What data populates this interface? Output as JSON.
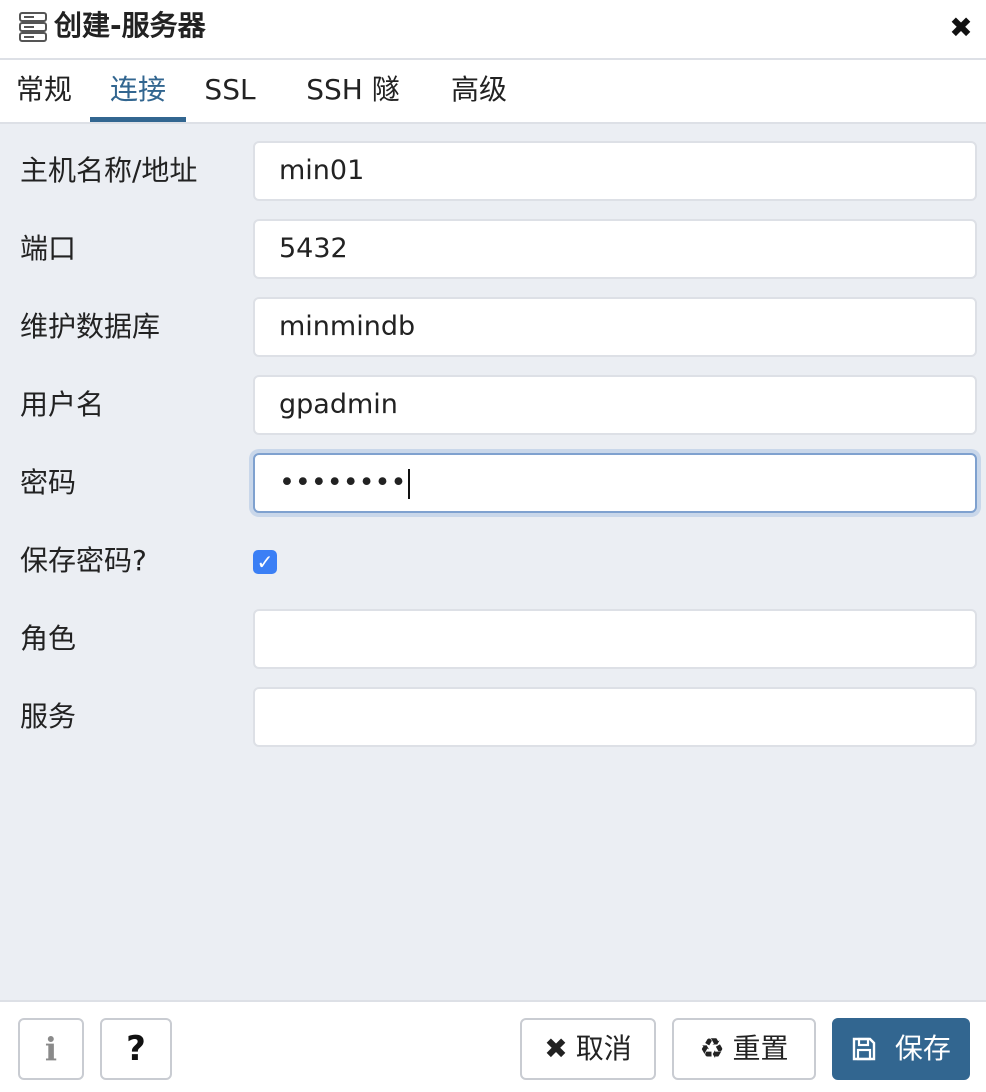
{
  "dialog": {
    "title": "创建-服务器",
    "icons": {
      "title": "server-icon",
      "close": "close-icon"
    },
    "close_glyph": "✖"
  },
  "tabs": [
    {
      "label": "常规",
      "active": false
    },
    {
      "label": "连接",
      "active": true
    },
    {
      "label": "SSL",
      "active": false
    },
    {
      "label": "SSH 隧道",
      "active": false
    },
    {
      "label": "高级",
      "active": false
    }
  ],
  "fields": {
    "host": {
      "label": "主机名称/地址",
      "value": "min01"
    },
    "port": {
      "label": "端口",
      "value": "5432"
    },
    "maintenance_db": {
      "label": "维护数据库",
      "value": "minmindb"
    },
    "username": {
      "label": "用户名",
      "value": "gpadmin"
    },
    "password": {
      "label": "密码",
      "value": "••••••••"
    },
    "save_password": {
      "label": "保存密码?",
      "checked": true,
      "check_glyph": "✓"
    },
    "role": {
      "label": "角色",
      "value": ""
    },
    "service": {
      "label": "服务",
      "value": ""
    }
  },
  "footer": {
    "info": {
      "glyph": "i",
      "icon": "info-icon"
    },
    "help": {
      "glyph": "?",
      "icon": "question-icon"
    },
    "cancel": {
      "label": "取消",
      "glyph": "✖",
      "icon": "close-icon"
    },
    "reset": {
      "label": "重置",
      "glyph": "♻",
      "icon": "recycle-icon"
    },
    "save": {
      "label": "保存",
      "icon": "floppy-disk-icon"
    }
  },
  "colors": {
    "accent": "#326690",
    "panel_background": "#ebeef3",
    "checkbox": "#3b7ff5",
    "focus_border": "#7fa1cf"
  }
}
